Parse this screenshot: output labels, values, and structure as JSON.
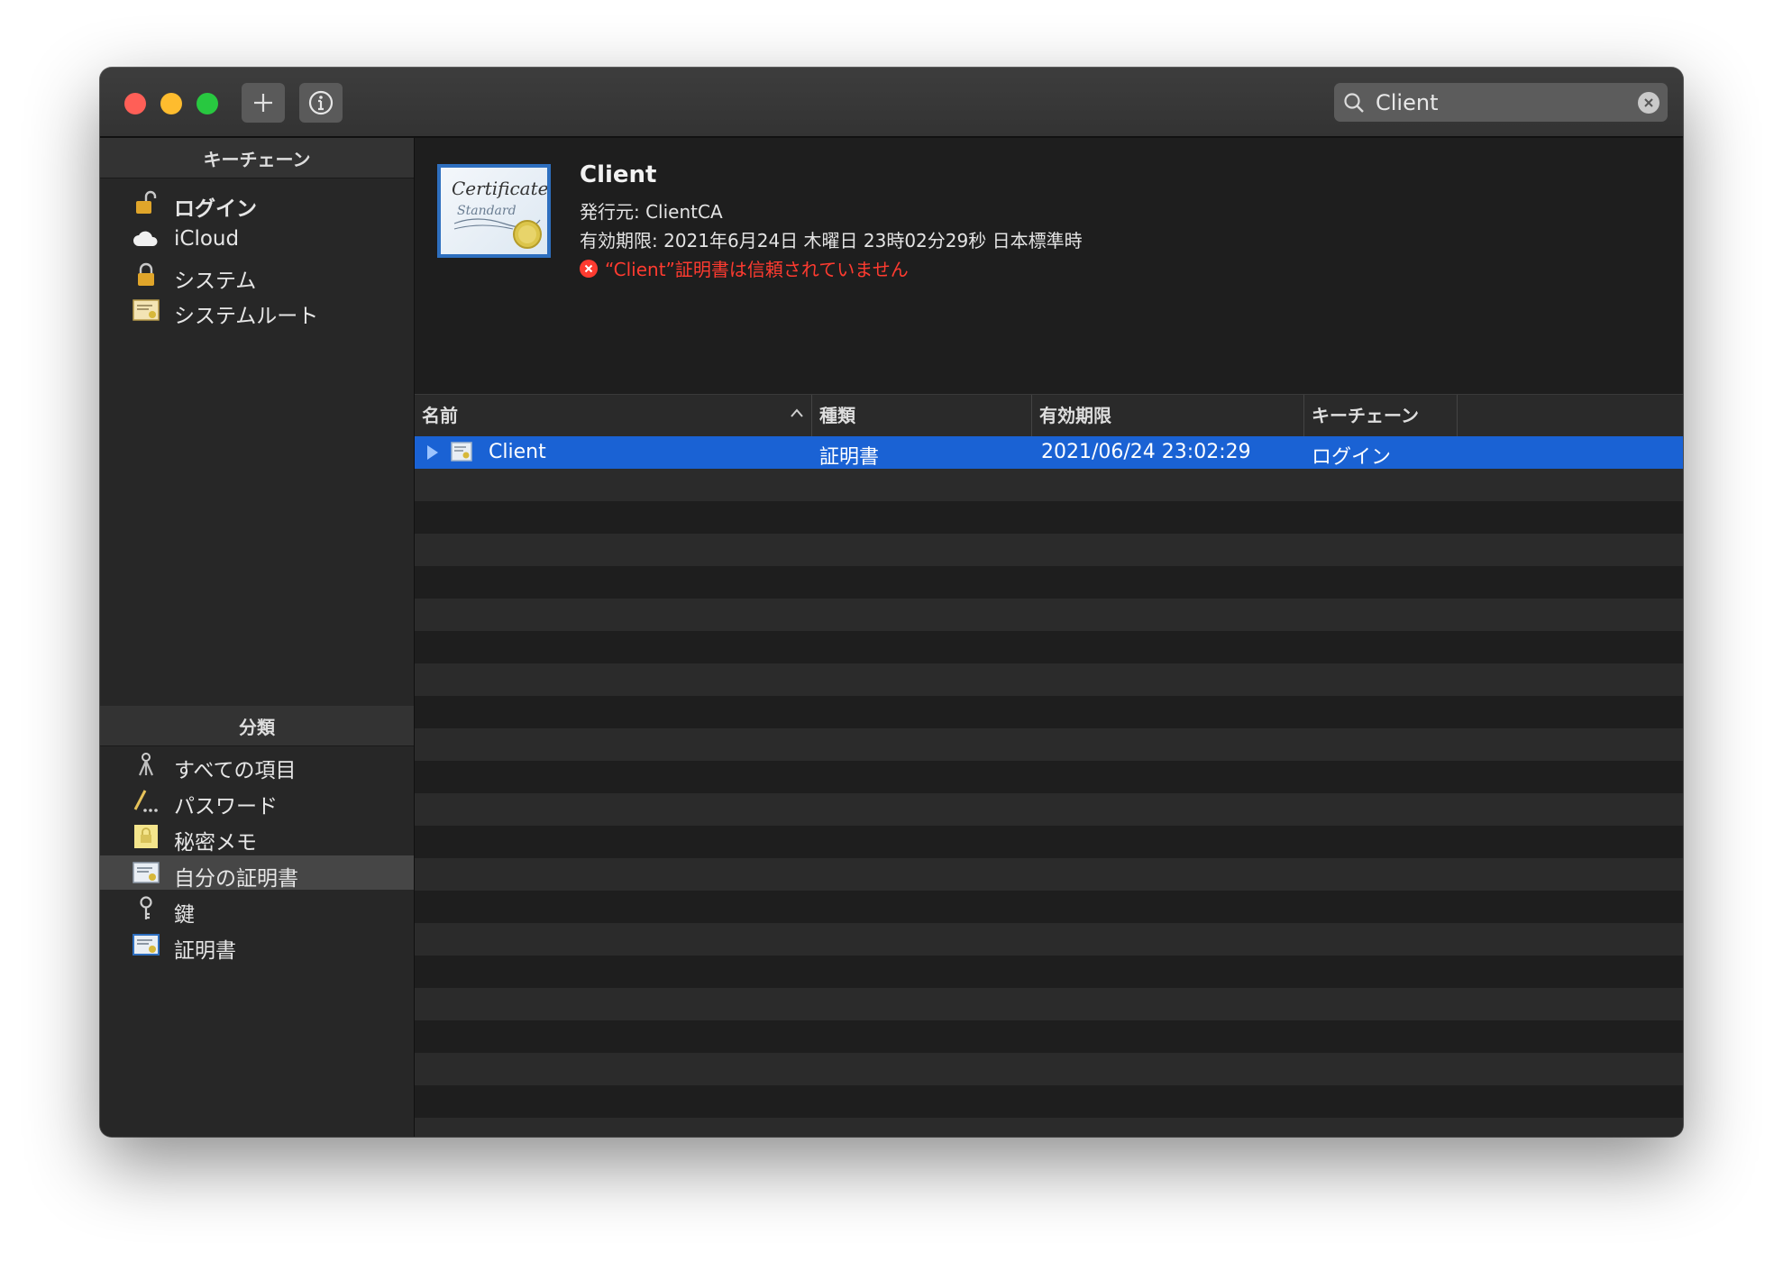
{
  "search": {
    "value": "Client"
  },
  "sidebar": {
    "keychains_header": "キーチェーン",
    "keychains": [
      {
        "label": "ログイン",
        "icon": "unlocked-padlock-icon",
        "bold": true
      },
      {
        "label": "iCloud",
        "icon": "cloud-icon",
        "bold": false
      },
      {
        "label": "システム",
        "icon": "padlock-icon",
        "bold": false
      },
      {
        "label": "システムルート",
        "icon": "root-certificate-icon",
        "bold": false
      }
    ],
    "category_header": "分類",
    "categories": [
      {
        "label": "すべての項目",
        "icon": "all-items-keys-icon"
      },
      {
        "label": "パスワード",
        "icon": "password-pencil-icon"
      },
      {
        "label": "秘密メモ",
        "icon": "secure-note-icon"
      },
      {
        "label": "自分の証明書",
        "icon": "my-certificate-icon",
        "selected": true
      },
      {
        "label": "鍵",
        "icon": "key-icon"
      },
      {
        "label": "証明書",
        "icon": "certificate-icon"
      }
    ]
  },
  "detail": {
    "title": "Client",
    "issuer": "発行元: ClientCA",
    "expiry": "有効期限: 2021年6月24日 木曜日 23時02分29秒 日本標準時",
    "warning": "“Client”証明書は信頼されていません",
    "cert_text_1": "Certificate",
    "cert_text_2": "Standard"
  },
  "table": {
    "columns": [
      "名前",
      "種類",
      "有効期限",
      "キーチェーン"
    ],
    "rows": [
      {
        "name": "Client",
        "kind": "証明書",
        "expires": "2021/06/24 23:02:29",
        "keychain": "ログイン",
        "selected": true
      }
    ]
  },
  "colors": {
    "selection": "#1a62d4",
    "warning": "#ff3b30",
    "close": "#ff5f57",
    "minimize": "#febc2e",
    "maximize": "#28c840"
  }
}
